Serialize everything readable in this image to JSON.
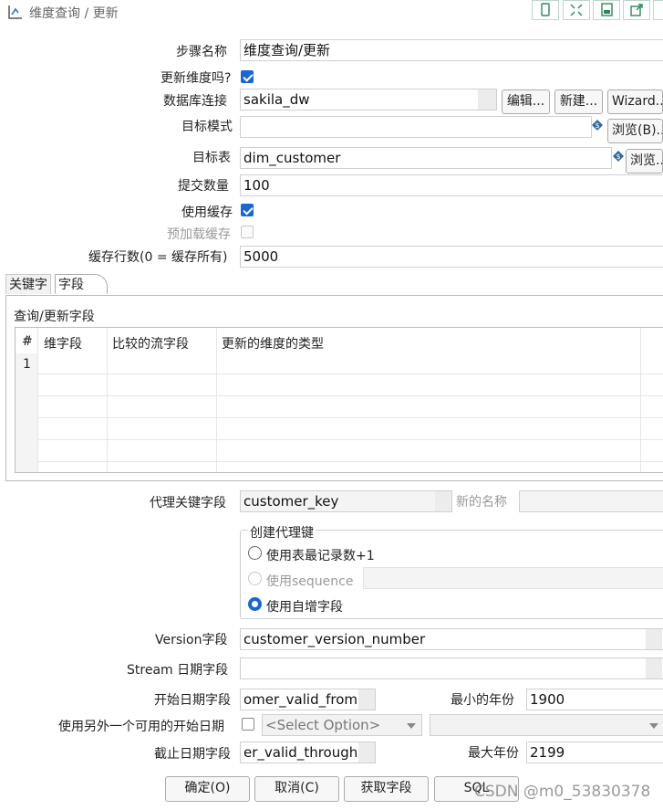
{
  "window": {
    "title": "维度查询 / 更新"
  },
  "toolbar_icons": [
    "phone-icon",
    "expand-icon",
    "save-icon",
    "export-icon",
    "more-icon"
  ],
  "form": {
    "step_name_label": "步骤名称",
    "step_name_value": "维度查询/更新",
    "update_dim_label": "更新维度吗?",
    "update_dim_checked": true,
    "db_conn_label": "数据库连接",
    "db_conn_value": "sakila_dw",
    "edit_button": "编辑...",
    "new_button": "新建...",
    "wizard_button": "Wizard...",
    "target_schema_label": "目标模式",
    "target_schema_value": "",
    "browse_b_button": "浏览(B)...",
    "target_table_label": "目标表",
    "target_table_value": "dim_customer",
    "browse_button": "浏览...",
    "commit_size_label": "提交数量",
    "commit_size_value": "100",
    "use_cache_label": "使用缓存",
    "use_cache_checked": true,
    "preload_cache_label": "预加载缓存",
    "preload_cache_checked": false,
    "cache_rows_label": "缓存行数(0 = 缓存所有)",
    "cache_rows_value": "5000"
  },
  "tabs": [
    {
      "label": "关键字"
    },
    {
      "label": "字段"
    }
  ],
  "fields_group": {
    "title": "查询/更新字段",
    "columns": [
      "#",
      "维字段",
      "比较的流字段",
      "更新的维度的类型"
    ],
    "rows": [
      {
        "num": "1"
      }
    ]
  },
  "surrogate": {
    "key_label": "代理关键字段",
    "key_value": "customer_key",
    "new_name_label": "新的名称",
    "new_name_value": "",
    "group_title": "创建代理键",
    "opt_max": "使用表最记录数+1",
    "opt_sequence": "使用sequence",
    "opt_auto": "使用自增字段"
  },
  "version": {
    "label": "Version字段",
    "value": "customer_version_number"
  },
  "stream_date": {
    "label": "Stream 日期字段",
    "value": ""
  },
  "dates": {
    "start_label": "开始日期字段",
    "start_value": "omer_valid_from",
    "min_year_label": "最小的年份",
    "min_year_value": "1900",
    "alt_start_label": "使用另外一个可用的开始日期",
    "alt_start_checked": false,
    "select_placeholder": "<Select Option>",
    "end_label": "截止日期字段",
    "end_value": "er_valid_through",
    "max_year_label": "最大年份",
    "max_year_value": "2199"
  },
  "buttons": {
    "ok": "确定(O)",
    "cancel": "取消(C)",
    "get_fields": "获取字段",
    "sql": "SQL"
  },
  "watermark": "CSDN @m0_53830378"
}
